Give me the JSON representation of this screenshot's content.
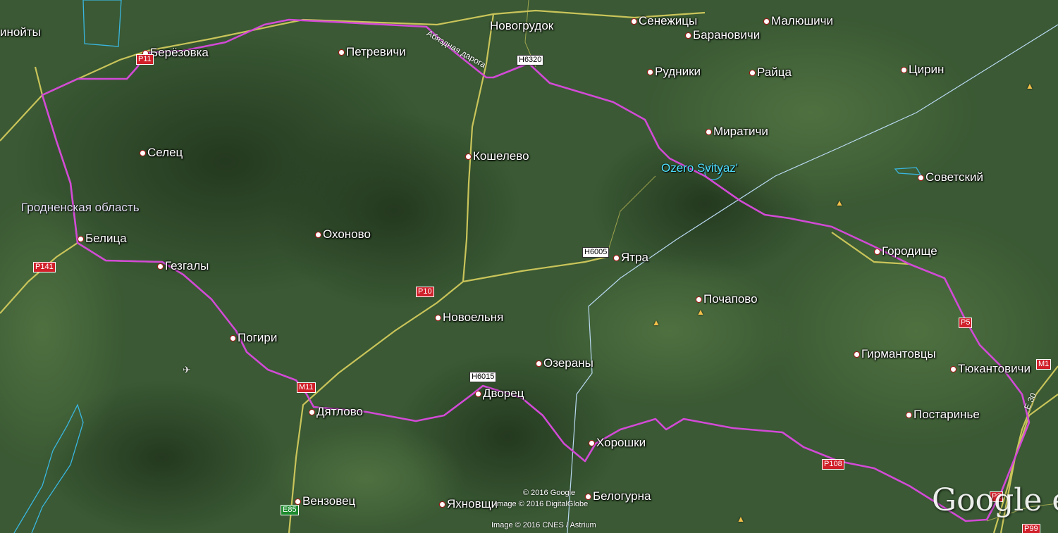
{
  "places": [
    {
      "id": "ahoity",
      "name": "инойты"
    },
    {
      "id": "berezovka",
      "name": "Берёзовка"
    },
    {
      "id": "petrevichi",
      "name": "Петревичи"
    },
    {
      "id": "novogrudok",
      "name": "Новогрудок"
    },
    {
      "id": "senezhitsy",
      "name": "Сенежицы"
    },
    {
      "id": "maloshichi",
      "name": "Малюшичи"
    },
    {
      "id": "baranovichi",
      "name": "Барановичи"
    },
    {
      "id": "rudniki",
      "name": "Рудники"
    },
    {
      "id": "raitsa",
      "name": "Райца"
    },
    {
      "id": "tsirin",
      "name": "Цирин"
    },
    {
      "id": "miratichi",
      "name": "Миратичи"
    },
    {
      "id": "selets",
      "name": "Селец"
    },
    {
      "id": "koshelevo",
      "name": "Кошелево"
    },
    {
      "id": "sovetsky",
      "name": "Советский"
    },
    {
      "id": "belitsa",
      "name": "Белица"
    },
    {
      "id": "ohonovo",
      "name": "Охоново"
    },
    {
      "id": "yatra",
      "name": "Ятра"
    },
    {
      "id": "gorodishche",
      "name": "Городище"
    },
    {
      "id": "gezgaly",
      "name": "Гезгалы"
    },
    {
      "id": "novoelnya",
      "name": "Новоельня"
    },
    {
      "id": "pochapovo",
      "name": "Почапово"
    },
    {
      "id": "pogiri",
      "name": "Погири"
    },
    {
      "id": "gyrmantovtsy",
      "name": "Гирмантовцы"
    },
    {
      "id": "ozerany",
      "name": "Озераны"
    },
    {
      "id": "tyukantovichi",
      "name": "Тюкантовичи"
    },
    {
      "id": "dyatlovo",
      "name": "Дятлово"
    },
    {
      "id": "dvorets",
      "name": "Дворец"
    },
    {
      "id": "postarinye",
      "name": "Постаринье"
    },
    {
      "id": "horoshki",
      "name": "Хорошки"
    },
    {
      "id": "venzovets",
      "name": "Вензовец"
    },
    {
      "id": "yahnovshchi",
      "name": "Яхновщи"
    },
    {
      "id": "belogurna",
      "name": "Белогурна"
    }
  ],
  "region_label": "Гродненская область",
  "lake_label": "Ozero Svityaz'",
  "road_shields": [
    {
      "id": "p11",
      "label": "P11",
      "style": "red"
    },
    {
      "id": "h6320",
      "label": "H6320",
      "style": "white"
    },
    {
      "id": "h6005",
      "label": "H6005",
      "style": "white"
    },
    {
      "id": "p141",
      "label": "P141",
      "style": "red"
    },
    {
      "id": "p10",
      "label": "P10",
      "style": "red"
    },
    {
      "id": "p5",
      "label": "P5",
      "style": "red"
    },
    {
      "id": "h6015",
      "label": "H6015",
      "style": "white"
    },
    {
      "id": "m11",
      "label": "M11",
      "style": "red"
    },
    {
      "id": "m1",
      "label": "M1",
      "style": "red"
    },
    {
      "id": "p108",
      "label": "P108",
      "style": "red"
    },
    {
      "id": "e85",
      "label": "E85",
      "style": "green"
    },
    {
      "id": "p2",
      "label": "P2",
      "style": "red"
    },
    {
      "id": "p99",
      "label": "P99",
      "style": "red"
    }
  ],
  "road_labels": {
    "bypass": "Абяздная дарога",
    "e30": "E 30"
  },
  "attribution": {
    "line1": "© 2016 Google",
    "line2": "Image © 2016 DigitalGlobe",
    "line3": "Image © 2016 CNES / Astrium"
  },
  "logo": "Google e",
  "colors": {
    "route": "#d24ad6",
    "roads": "#c9c45a",
    "border": "#b9d9f2",
    "water": "#3ab6e0"
  }
}
